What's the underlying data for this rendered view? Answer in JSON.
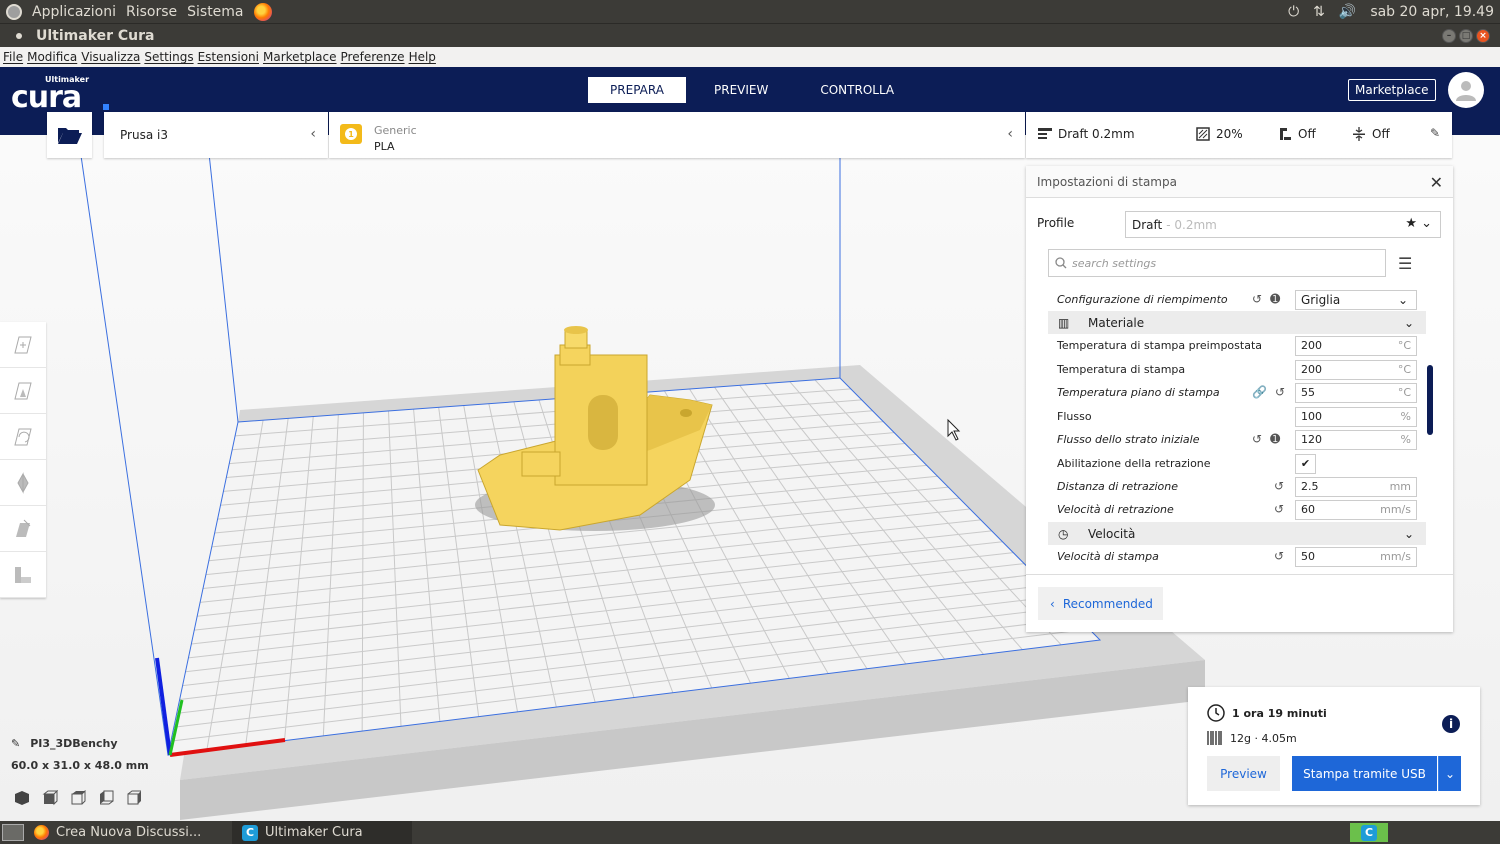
{
  "top_panel": {
    "menus": [
      "Applicazioni",
      "Risorse",
      "Sistema"
    ],
    "clock": "sab 20 apr, 19.49"
  },
  "window": {
    "title": "Ultimaker Cura"
  },
  "menu_bar": [
    "File",
    "Modifica",
    "Visualizza",
    "Settings",
    "Estensioni",
    "Marketplace",
    "Preferenze",
    "Help"
  ],
  "header": {
    "logo_small": "Ultimaker",
    "logo_big": "cura",
    "tabs": [
      {
        "label": "PREPARA",
        "active": true
      },
      {
        "label": "PREVIEW",
        "active": false
      },
      {
        "label": "CONTROLLA",
        "active": false
      }
    ],
    "marketplace_label": "Marketplace"
  },
  "toolbar": {
    "printer": "Prusa i3",
    "material_brand": "Generic",
    "material": "PLA",
    "extruder_number": "1",
    "profile_summary": "Draft 0.2mm",
    "infill": "20%",
    "support": "Off",
    "adhesion": "Off"
  },
  "print_settings": {
    "title": "Impostazioni di stampa",
    "profile_label": "Profile",
    "profile_name": "Draft",
    "profile_layer": "- 0.2mm",
    "search_placeholder": "search settings",
    "rows": [
      {
        "type": "select",
        "label": "Configurazione di riempimento",
        "italic": true,
        "value": "Griglia",
        "reset": true,
        "info": true
      },
      {
        "type": "category",
        "label": "Materiale",
        "icon": "material"
      },
      {
        "type": "field",
        "label": "Temperatura di stampa preimpostata",
        "italic": false,
        "value": "200",
        "unit": "°C"
      },
      {
        "type": "field",
        "label": "Temperatura di stampa",
        "italic": false,
        "value": "200",
        "unit": "°C"
      },
      {
        "type": "field",
        "label": "Temperatura piano di stampa",
        "italic": true,
        "value": "55",
        "unit": "°C",
        "link": true,
        "reset": true
      },
      {
        "type": "field",
        "label": "Flusso",
        "italic": false,
        "value": "100",
        "unit": "%"
      },
      {
        "type": "field",
        "label": "Flusso dello strato iniziale",
        "italic": true,
        "value": "120",
        "unit": "%",
        "reset": true,
        "info": true
      },
      {
        "type": "check",
        "label": "Abilitazione della retrazione",
        "italic": false,
        "checked": true
      },
      {
        "type": "field",
        "label": "Distanza di retrazione",
        "italic": true,
        "value": "2.5",
        "unit": "mm",
        "reset": true
      },
      {
        "type": "field",
        "label": "Velocità di retrazione",
        "italic": true,
        "value": "60",
        "unit": "mm/s",
        "reset": true
      },
      {
        "type": "category",
        "label": "Velocità",
        "icon": "speed"
      },
      {
        "type": "field",
        "label": "Velocità di stampa",
        "italic": true,
        "value": "50",
        "unit": "mm/s",
        "reset": true
      }
    ],
    "recommended_label": "Recommended"
  },
  "object": {
    "name": "PI3_3DBenchy",
    "dimensions": "60.0 x 31.0 x 48.0 mm"
  },
  "job": {
    "time": "1 ora 19 minuti",
    "material_usage": "12g · 4.05m",
    "preview_label": "Preview",
    "print_label": "Stampa tramite USB"
  },
  "taskbar": {
    "tasks": [
      {
        "label": "Crea Nuova Discussi...",
        "active": false
      },
      {
        "label": "Ultimaker Cura",
        "active": true
      }
    ]
  },
  "colors": {
    "cura_blue": "#0c1d56",
    "accent_blue": "#1e67d8",
    "model_yellow": "#f5d45e",
    "ubuntu_panel": "#3c3b37"
  }
}
